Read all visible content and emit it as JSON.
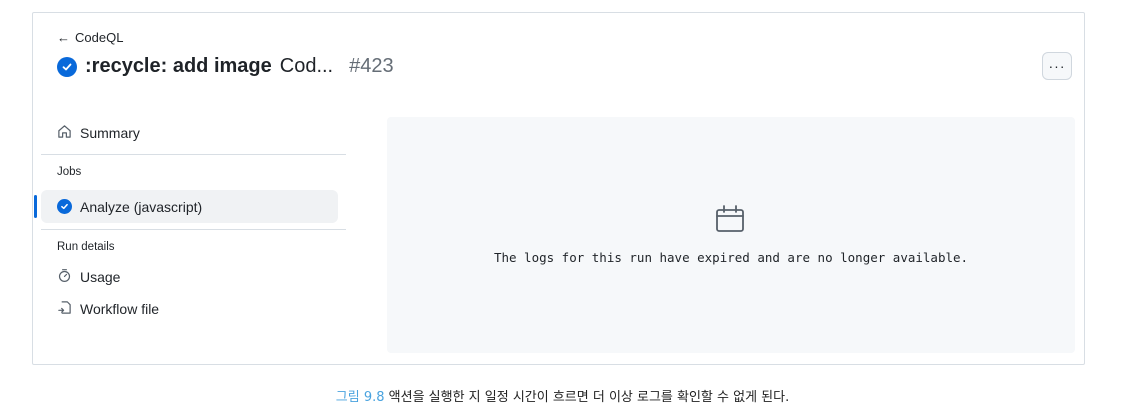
{
  "header": {
    "back_label": "CodeQL",
    "title_bold": ":recycle: add image",
    "title_rest": "Cod...",
    "run_number": "#423",
    "more_label": "···"
  },
  "sidebar": {
    "summary_label": "Summary",
    "jobs_heading": "Jobs",
    "jobs": [
      {
        "label": "Analyze (javascript)",
        "status": "success",
        "selected": true
      }
    ],
    "run_details_heading": "Run details",
    "details": [
      {
        "label": "Usage",
        "icon": "stopwatch-icon"
      },
      {
        "label": "Workflow file",
        "icon": "workflow-file-icon"
      }
    ]
  },
  "main": {
    "icon": "calendar-icon",
    "message": "The logs for this run have expired and are no longer available."
  },
  "caption": {
    "label": "그림 9.8",
    "text": "액션을 실행한 지 일정 시간이 흐르면 더 이상 로그를 확인할 수 없게 된다."
  },
  "colors": {
    "accent": "#0969da",
    "border": "#d8dee4",
    "panel_bg": "#f6f8fa",
    "caption_label": "#4aa3df"
  }
}
